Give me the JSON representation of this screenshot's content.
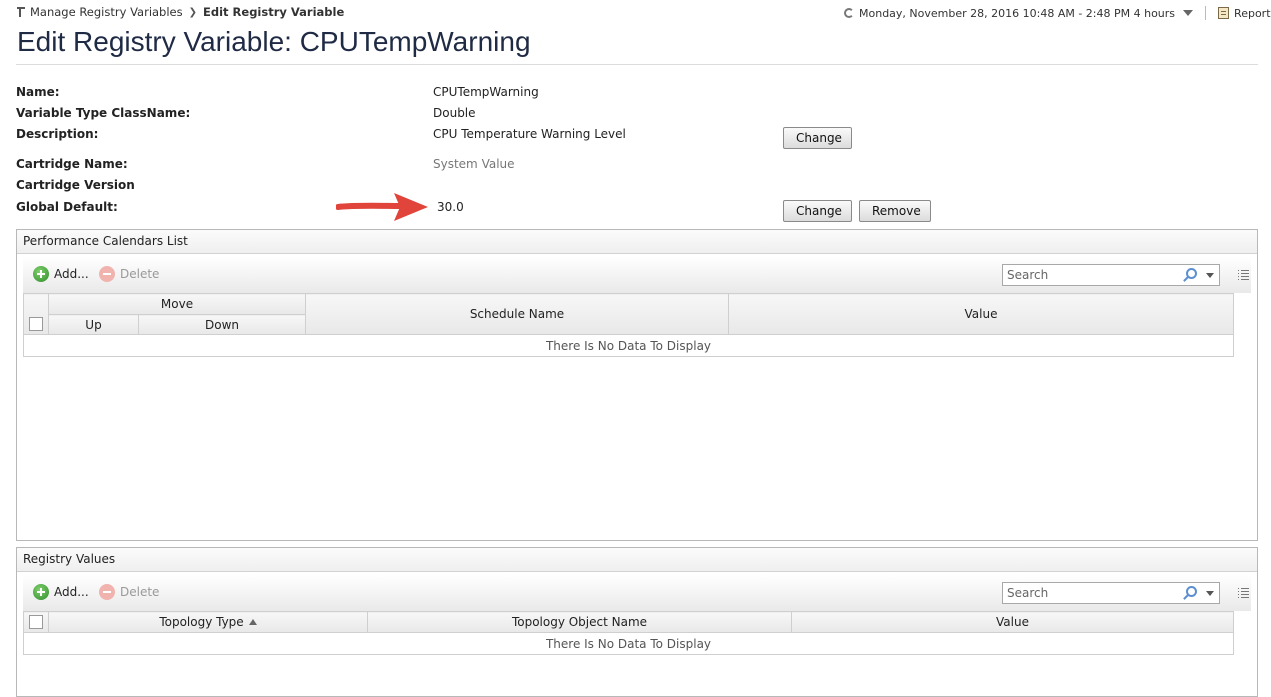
{
  "breadcrumb": {
    "parent": "Manage Registry Variables",
    "current": "Edit Registry Variable"
  },
  "timebar": {
    "range": "Monday, November 28, 2016 10:48 AM - 2:48 PM 4 hours",
    "reports": "Reports"
  },
  "page": {
    "title": "Edit Registry Variable: CPUTempWarning"
  },
  "properties": {
    "name_label": "Name:",
    "name_value": "CPUTempWarning",
    "type_label": "Variable Type ClassName:",
    "type_value": "Double",
    "description_label": "Description:",
    "description_value": "CPU Temperature Warning Level",
    "cartridge_name_label": "Cartridge Name:",
    "cartridge_name_value": "System Value",
    "cartridge_version_label": "Cartridge Version",
    "global_default_label": "Global Default:",
    "global_default_value": "30.0"
  },
  "buttons": {
    "change_description": "Change",
    "change_default": "Change",
    "remove_default": "Remove"
  },
  "colors": {
    "annotation_arrow": "#e0443a",
    "title": "#1f2a44"
  },
  "calendars_panel": {
    "title": "Performance Calendars List",
    "add": "Add...",
    "delete": "Delete",
    "search_placeholder": "Search",
    "columns": {
      "move": "Move",
      "up": "Up",
      "down": "Down",
      "schedule_name": "Schedule Name",
      "value": "Value"
    },
    "empty_message": "There Is No Data To Display"
  },
  "registry_panel": {
    "title": "Registry Values",
    "add": "Add...",
    "delete": "Delete",
    "search_placeholder": "Search",
    "columns": {
      "topology_type": "Topology Type",
      "topology_object_name": "Topology Object Name",
      "value": "Value"
    },
    "sort": "ascending",
    "empty_message": "There Is No Data To Display"
  }
}
